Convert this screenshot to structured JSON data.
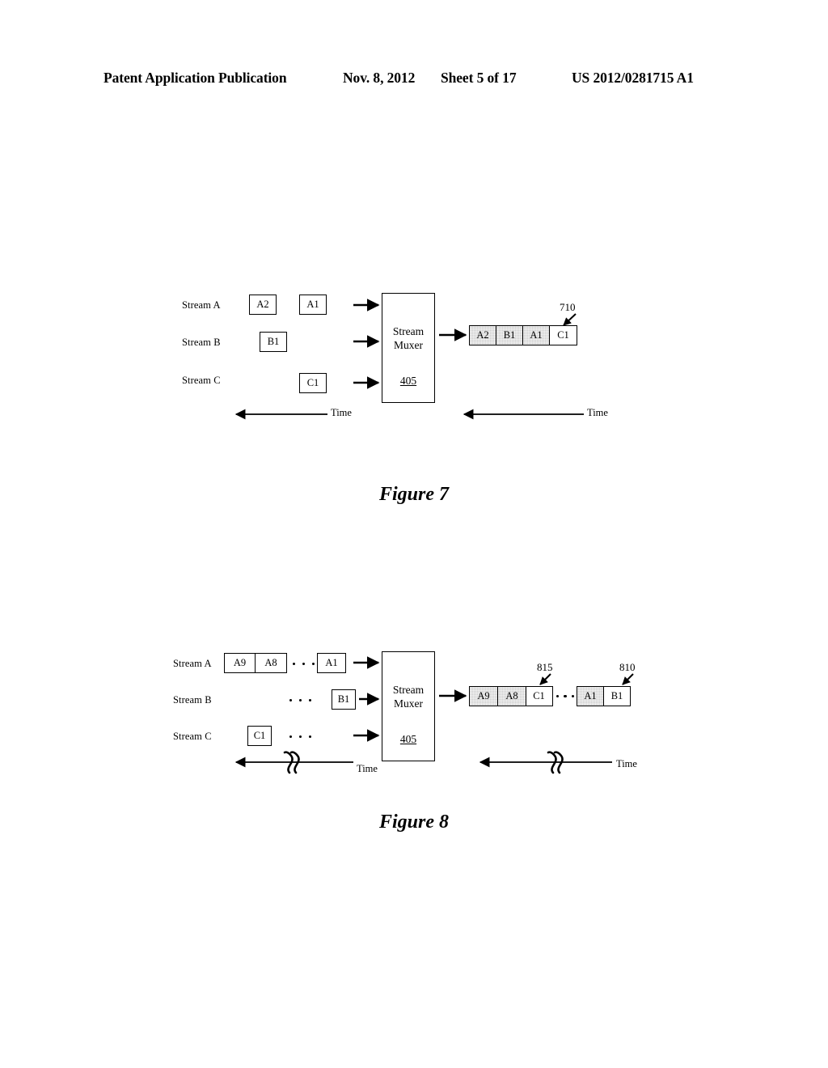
{
  "header": {
    "publication": "Patent Application Publication",
    "date": "Nov. 8, 2012",
    "sheet": "Sheet 5 of 17",
    "patent_number": "US 2012/0281715 A1"
  },
  "figure7": {
    "caption": "Figure 7",
    "stream_labels": {
      "a": "Stream A",
      "b": "Stream B",
      "c": "Stream C"
    },
    "input_packets": {
      "a2": "A2",
      "a1": "A1",
      "b1": "B1",
      "c1": "C1"
    },
    "muxer": {
      "line1": "Stream",
      "line2": "Muxer",
      "ref": "405"
    },
    "output_stream": {
      "ref": "710",
      "cells": [
        {
          "label": "A2",
          "shaded": true
        },
        {
          "label": "B1",
          "shaded": true
        },
        {
          "label": "A1",
          "shaded": true
        },
        {
          "label": "C1",
          "shaded": false
        }
      ]
    },
    "time_label_left": "Time",
    "time_label_right": "Time"
  },
  "figure8": {
    "caption": "Figure 8",
    "stream_labels": {
      "a": "Stream A",
      "b": "Stream B",
      "c": "Stream C"
    },
    "input_stream_a": {
      "group": [
        {
          "label": "A9"
        },
        {
          "label": "A8"
        }
      ],
      "tail": "A1"
    },
    "input_stream_b": {
      "packet": "B1"
    },
    "input_stream_c": {
      "packet": "C1"
    },
    "muxer": {
      "line1": "Stream",
      "line2": "Muxer",
      "ref": "405"
    },
    "output_group_left": {
      "ref": "815",
      "cells": [
        {
          "label": "A9",
          "shaded": true
        },
        {
          "label": "A8",
          "shaded": true
        },
        {
          "label": "C1",
          "shaded": false
        }
      ]
    },
    "output_group_right": {
      "ref": "810",
      "cells": [
        {
          "label": "A1",
          "shaded": true
        },
        {
          "label": "B1",
          "shaded": false
        }
      ]
    },
    "time_label_left": "Time",
    "time_label_right": "Time"
  }
}
